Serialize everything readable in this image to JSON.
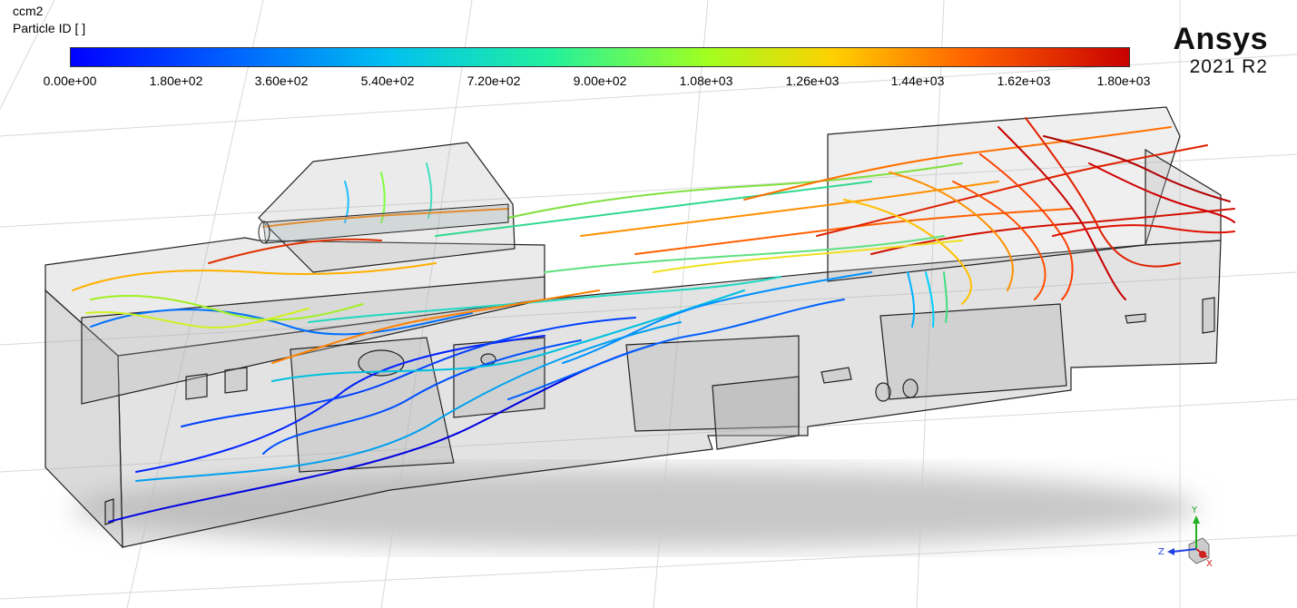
{
  "case_name": "ccm2",
  "variable": "Particle ID [ ]",
  "legend": {
    "ticks": [
      "0.00e+00",
      "1.80e+02",
      "3.60e+02",
      "5.40e+02",
      "7.20e+02",
      "9.00e+02",
      "1.08e+03",
      "1.26e+03",
      "1.44e+03",
      "1.62e+03",
      "1.80e+03"
    ],
    "range": [
      0,
      1800
    ],
    "colors": [
      "#0000ff",
      "#0080ff",
      "#00e0e0",
      "#20ff80",
      "#c0ff20",
      "#ffd000",
      "#ff7000",
      "#d00000"
    ]
  },
  "logo": {
    "brand": "Ansys",
    "version": "2021 R2"
  },
  "triad": {
    "x": "X",
    "y": "Y",
    "z": "Z"
  }
}
